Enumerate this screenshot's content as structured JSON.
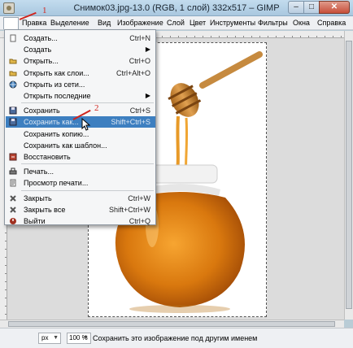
{
  "window": {
    "title": "Снимок03.jpg-13.0 (RGB, 1 слой) 332x517 – GIMP",
    "buttons": [
      "–",
      "□",
      "✕"
    ]
  },
  "menubar": {
    "items": [
      {
        "label": "",
        "active": true
      },
      {
        "label": "Правка"
      },
      {
        "label": "Выделение"
      },
      {
        "label": "Вид"
      },
      {
        "label": "Изображение"
      },
      {
        "label": "Слой"
      },
      {
        "label": "Цвет"
      },
      {
        "label": "Инструменты"
      },
      {
        "label": "Фильтры"
      },
      {
        "label": "Окна"
      },
      {
        "label": "Справка"
      }
    ]
  },
  "file_menu": {
    "items": [
      {
        "label": "Создать...",
        "shortcut": "Ctrl+N",
        "icon": "new-file-icon",
        "icon_color": "#ffffff"
      },
      {
        "label": "Создать",
        "submenu": true,
        "icon": "none"
      },
      {
        "label": "Открыть...",
        "shortcut": "Ctrl+O",
        "icon": "open-folder-icon",
        "icon_color": "#e0b64a"
      },
      {
        "label": "Открыть как слои...",
        "shortcut": "Ctrl+Alt+O",
        "icon": "open-layers-icon",
        "icon_color": "#e0b64a"
      },
      {
        "label": "Открыть из сети...",
        "icon": "globe-icon",
        "icon_color": "#3f7fbf"
      },
      {
        "label": "Открыть последние",
        "submenu": true,
        "icon": "none"
      },
      {
        "separator": true
      },
      {
        "label": "Сохранить",
        "shortcut": "Ctrl+S",
        "icon": "save-icon",
        "icon_color": "#4c6c9c"
      },
      {
        "label": "Сохранить как...",
        "shortcut": "Shift+Ctrl+S",
        "icon": "save-as-icon",
        "icon_color": "#4c6c9c",
        "highlighted": true
      },
      {
        "label": "Сохранить копию...",
        "icon": "none"
      },
      {
        "label": "Сохранить как шаблон...",
        "icon": "none"
      },
      {
        "label": "Восстановить",
        "icon": "revert-icon",
        "icon_color": "#b8412f"
      },
      {
        "separator": true
      },
      {
        "label": "Печать...",
        "icon": "print-icon",
        "icon_color": "#777777"
      },
      {
        "label": "Просмотр печати...",
        "icon": "print-preview-icon",
        "icon_color": "#666666"
      },
      {
        "separator": true
      },
      {
        "label": "Закрыть",
        "shortcut": "Ctrl+W",
        "icon": "close-x-icon",
        "icon_color": "#555555"
      },
      {
        "label": "Закрыть все",
        "shortcut": "Shift+Ctrl+W",
        "icon": "close-all-icon",
        "icon_color": "#555555"
      },
      {
        "label": "Выйти",
        "shortcut": "Ctrl+Q",
        "icon": "quit-icon",
        "icon_color": "#a03020"
      }
    ]
  },
  "callouts": [
    {
      "number": "1"
    },
    {
      "number": "2"
    }
  ],
  "statusbar": {
    "unit": "px",
    "zoom": "100 %",
    "message": "Сохранить это изображение под другим именем"
  },
  "colors": {
    "highlight": "#3d7fc0",
    "callout": "#d0241c",
    "honey": "#e08a1a"
  }
}
